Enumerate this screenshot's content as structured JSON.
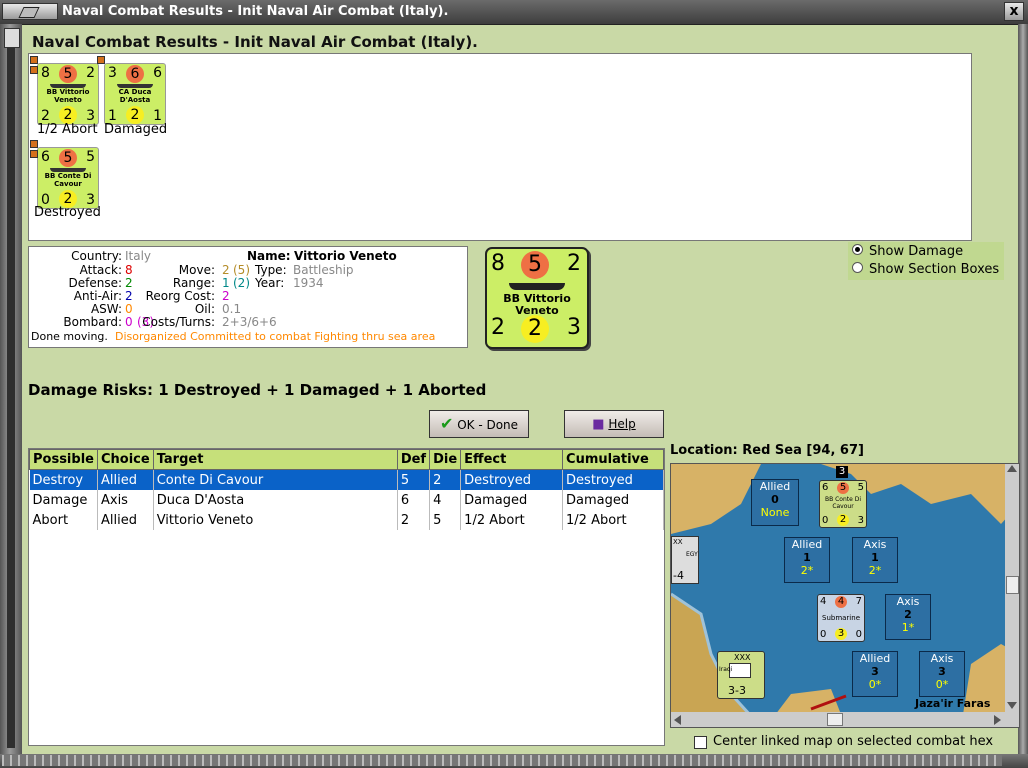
{
  "window": {
    "title": "Naval Combat Results - Init Naval Air Combat (Italy).",
    "close_label": "x"
  },
  "heading": "Naval Combat Results - Init Naval Air Combat (Italy).",
  "results": [
    {
      "top_left": "8",
      "top": "5",
      "top_right": "2",
      "name": "BB Vittorio Veneto",
      "bot_left": "2",
      "bot": "2",
      "bot_right": "3",
      "caption": "1/2 Abort"
    },
    {
      "top_left": "3",
      "top": "6",
      "top_right": "6",
      "name": "CA Duca D'Aosta",
      "bot_left": "1",
      "bot": "2",
      "bot_right": "1",
      "caption": "Damaged"
    },
    {
      "top_left": "6",
      "top": "5",
      "top_right": "5",
      "name": "BB Conte Di Cavour",
      "bot_left": "0",
      "bot": "2",
      "bot_right": "3",
      "caption": "Destroyed"
    }
  ],
  "info": {
    "country_label": "Country:",
    "country": "Italy",
    "name_label": "Name:",
    "name": "Vittorio Veneto",
    "attack_label": "Attack:",
    "attack": "8",
    "defense_label": "Defense:",
    "defense": "2",
    "antiair_label": "Anti-Air:",
    "antiair": "2",
    "asw_label": "ASW:",
    "asw": "0",
    "bombard_label": "Bombard:",
    "bombard": "0",
    "bombard_extra": "(3)",
    "move_label": "Move:",
    "move": "2",
    "move_extra": "(5)",
    "type_label": "Type:",
    "type": "Battleship",
    "range_label": "Range:",
    "range": "1",
    "range_extra": "(2)",
    "year_label": "Year:",
    "year": "1934",
    "reorg_label": "Reorg Cost:",
    "reorg": "2",
    "oil_label": "Oil:",
    "oil": "0.1",
    "costs_label": "Costs/Turns:",
    "costs": "2+3/6+6",
    "status_done": "Done moving.",
    "status_flags": "Disorganized Committed to combat Fighting thru sea area"
  },
  "big_counter": {
    "top_left": "8",
    "top": "5",
    "top_right": "2",
    "name_line1": "BB Vittorio",
    "name_line2": "Veneto",
    "bot_left": "2",
    "bot": "2",
    "bot_right": "3"
  },
  "options": {
    "show_damage": "Show Damage",
    "show_section_boxes": "Show Section Boxes",
    "selected": "show_damage"
  },
  "damage_risks": "Damage Risks: 1 Destroyed + 1 Damaged + 1 Aborted",
  "buttons": {
    "ok": "OK - Done",
    "help": "Help"
  },
  "table": {
    "headers": [
      "Possible",
      "Choice",
      "Target",
      "Def",
      "Die",
      "Effect",
      "Cumulative"
    ],
    "rows": [
      [
        "Destroy",
        "Allied",
        "Conte Di Cavour",
        "5",
        "2",
        "Destroyed",
        "Destroyed"
      ],
      [
        "Damage",
        "Axis",
        "Duca D'Aosta",
        "6",
        "4",
        "Damaged",
        "Damaged"
      ],
      [
        "Abort",
        "Allied",
        "Vittorio Veneto",
        "2",
        "5",
        "1/2 Abort",
        "1/2 Abort"
      ]
    ],
    "selected_row": 0
  },
  "location": "Location:  Red Sea [94, 67]",
  "map": {
    "boxes": [
      {
        "side": "Allied",
        "num": "0",
        "val": "None"
      },
      {
        "side": "Allied",
        "num": "1",
        "val": "2*"
      },
      {
        "side": "Axis",
        "num": "1",
        "val": "2*"
      },
      {
        "side": "Axis",
        "num": "2",
        "val": "1*"
      },
      {
        "side": "Allied",
        "num": "3",
        "val": "0*"
      },
      {
        "side": "Axis",
        "num": "3",
        "val": "0*"
      }
    ],
    "map_unit1": {
      "tl": "6",
      "t": "5",
      "tr": "5",
      "name": "BB Conte Di Cavour",
      "bl": "0",
      "b": "2",
      "br": "3"
    },
    "sub_unit": {
      "tl": "4",
      "t": "4",
      "tr": "7",
      "name": "Submarine",
      "bl": "0",
      "b": "3",
      "br": "0"
    },
    "corps_unit": {
      "size": "XXX",
      "side_label": "Iraqi",
      "value": "3-3"
    },
    "edge_unit": {
      "size": "XX",
      "label": "EGY",
      "value": "-4"
    },
    "stack_count": "3",
    "place_label": "Jaza'ir Faras"
  },
  "center_checkbox_label": "Center linked map on selected combat hex",
  "colors": {
    "background": "#c9d9a6",
    "counter": "#ccee66",
    "selected_row": "#0a62c8",
    "sea": "#2f79ab"
  }
}
